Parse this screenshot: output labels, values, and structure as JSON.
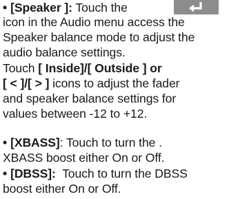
{
  "speaker": {
    "bullet": "•",
    "label": "[Speaker ]:",
    "lead": " Touch the",
    "icon": "enter-icon",
    "line2": "icon in the Audio menu access the",
    "line3": "Speaker balance mode to adjust the",
    "line4": "audio balance settings."
  },
  "fader": {
    "touch_prefix": "Touch ",
    "buttons_a": "[ Inside]/[ Outside ] or",
    "buttons_b": "[ < ]/[ > ]",
    "line5_rest": " icons to adjust the fader",
    "line6": "and speaker balance settings for",
    "line7": "values between -12 to +12."
  },
  "xbass": {
    "bullet": "•",
    "label": "[XBASS]",
    "text": ": Touch to turn the .",
    "line2": "XBASS boost either On or Off."
  },
  "dbss": {
    "bullet": "•",
    "label": "[DBSS]:",
    "text": "  Touch to turn the DBSS",
    "line2": "boost either On or Off."
  },
  "colors": {
    "text": "#1a1a1a",
    "icon_background": "#8c8c8c",
    "icon_arrow": "#ffffff"
  }
}
